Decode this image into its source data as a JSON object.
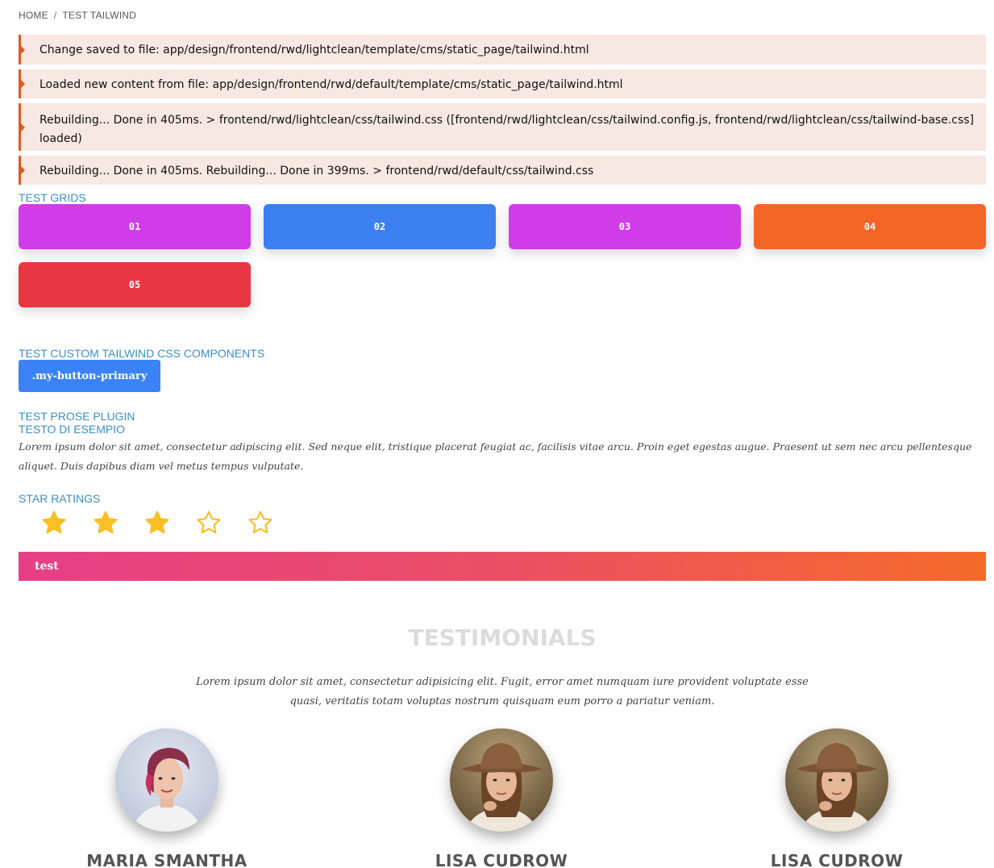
{
  "breadcrumb": {
    "home": "HOME",
    "separator": "/",
    "current": "TEST TAILWIND"
  },
  "messages": [
    "Change saved to file: app/design/frontend/rwd/lightclean/template/cms/static_page/tailwind.html",
    "Loaded new content from file: app/design/frontend/rwd/default/template/cms/static_page/tailwind.html",
    "Rebuilding... Done in 405ms. > frontend/rwd/lightclean/css/tailwind.css ([frontend/rwd/lightclean/css/tailwind.config.js, frontend/rwd/lightclean/css/tailwind-base.css] loaded)",
    "Rebuilding... Done in 405ms. Rebuilding... Done in 399ms. > frontend/rwd/default/css/tailwind.css"
  ],
  "grids": {
    "label": "TEST GRIDS",
    "tiles": [
      {
        "label": "01",
        "color": "#d03ce8"
      },
      {
        "label": "02",
        "color": "#3b7ff0"
      },
      {
        "label": "03",
        "color": "#d03ce8"
      },
      {
        "label": "04",
        "color": "#f46626"
      },
      {
        "label": "05",
        "color": "#e83642"
      }
    ]
  },
  "components": {
    "label": "TEST CUSTOM TAILWIND CSS COMPONENTS",
    "button_label": ".my-button-primary"
  },
  "prose": {
    "label": "TEST PROSE PLUGIN",
    "heading": "TESTO DI ESEMPIO",
    "paragraph": "Lorem ipsum dolor sit amet, consectetur adipiscing elit. Sed neque elit, tristique placerat feugiat ac, facilisis vitae arcu. Proin eget egestas augue. Praesent ut sem nec arcu pellentesque aliquet. Duis dapibus diam vel metus tempus vulputate."
  },
  "ratings": {
    "label": "STAR RATINGS",
    "filled": 3,
    "total": 5,
    "color": "#fbbf24"
  },
  "gradient_bar": {
    "label": "test"
  },
  "testimonials": {
    "title": "TESTIMONIALS",
    "text": "Lorem ipsum dolor sit amet, consectetur adipisicing elit. Fugit, error amet numquam iure provident voluptate esse quasi, veritatis totam voluptas nostrum quisquam eum porro a pariatur veniam.",
    "people": [
      {
        "name": "MARIA SMANTHA"
      },
      {
        "name": "LISA CUDROW"
      },
      {
        "name": "LISA CUDROW"
      }
    ]
  }
}
